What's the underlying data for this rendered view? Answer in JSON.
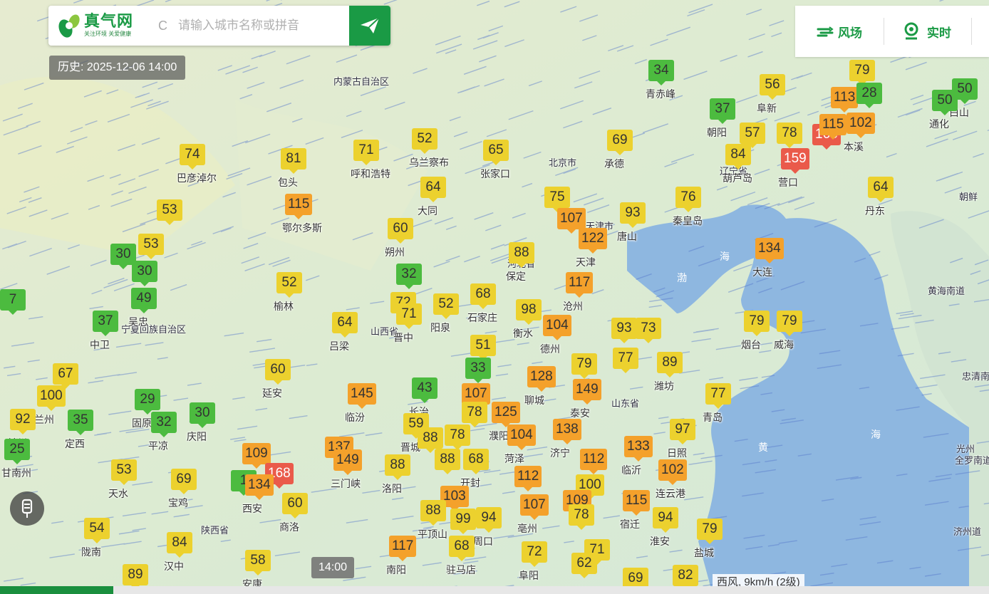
{
  "app": {
    "logo_name": "真气网",
    "logo_slogan": "关注环境 关爱健康",
    "search_placeholder": "请输入城市名称或拼音",
    "search_prefix": "C",
    "history_label": "历史: 2025-12-06 14:00",
    "modes": [
      {
        "label": "风场",
        "icon": "wind-icon"
      },
      {
        "label": "实时",
        "icon": "location-pin-icon"
      }
    ],
    "time_chip": "14:00",
    "wind_info": "西风, 9km/h (2级)",
    "timeline_progress": 0.34
  },
  "colors": {
    "brand": "#1a9a45",
    "good": "#4cbb3f",
    "moderate": "#ecd12e",
    "light": "#f4a12b",
    "medium": "#ea5a4a"
  },
  "map_labels": {
    "provinces": [
      "内蒙古自治区",
      "北京市",
      "天津市",
      "河北省",
      "山西省",
      "陕西省",
      "山东省",
      "宁夏回族自治区",
      "辽宁省"
    ],
    "seas": [
      "渤",
      "海",
      "黄",
      "海"
    ],
    "countries": [
      "朝鲜",
      "黄海南道",
      "忠清南道",
      "光州",
      "全罗南道",
      "济州道"
    ]
  },
  "markers": [
    {
      "v": "34",
      "c": "青赤峰"
    },
    {
      "v": "56",
      "c": "阜新"
    },
    {
      "v": "37",
      "c": "朝阳"
    },
    {
      "v": "57",
      "c": ""
    },
    {
      "v": "78",
      "c": ""
    },
    {
      "v": "166",
      "c": ""
    },
    {
      "v": "84",
      "c": "葫芦岛"
    },
    {
      "v": "159",
      "c": "营口"
    },
    {
      "v": "79",
      "c": ""
    },
    {
      "v": "113",
      "c": ""
    },
    {
      "v": "28",
      "c": ""
    },
    {
      "v": "115",
      "c": ""
    },
    {
      "v": "102",
      "c": "本溪"
    },
    {
      "v": "50",
      "c": "白山"
    },
    {
      "v": "50",
      "c": "通化"
    },
    {
      "v": "64",
      "c": "丹东"
    },
    {
      "v": "74",
      "c": "巴彦淖尔"
    },
    {
      "v": "81",
      "c": "包头"
    },
    {
      "v": "71",
      "c": "呼和浩特"
    },
    {
      "v": "52",
      "c": "乌兰察布"
    },
    {
      "v": "65",
      "c": "张家口"
    },
    {
      "v": "69",
      "c": "承德"
    },
    {
      "v": "115",
      "c": "鄂尔多斯"
    },
    {
      "v": "64",
      "c": "大同"
    },
    {
      "v": "75",
      "c": ""
    },
    {
      "v": "107",
      "c": ""
    },
    {
      "v": "93",
      "c": "唐山"
    },
    {
      "v": "76",
      "c": "秦皇岛"
    },
    {
      "v": "122",
      "c": "天津"
    },
    {
      "v": "53",
      "c": ""
    },
    {
      "v": "53",
      "c": ""
    },
    {
      "v": "30",
      "c": ""
    },
    {
      "v": "30",
      "c": ""
    },
    {
      "v": "49",
      "c": "吴忠"
    },
    {
      "v": "60",
      "c": "朔州"
    },
    {
      "v": "88",
      "c": "保定"
    },
    {
      "v": "134",
      "c": "大连"
    },
    {
      "v": "32",
      "c": ""
    },
    {
      "v": "52",
      "c": "榆林"
    },
    {
      "v": "117",
      "c": "沧州"
    },
    {
      "v": "37",
      "c": "中卫"
    },
    {
      "v": "64",
      "c": "吕梁"
    },
    {
      "v": "72",
      "c": ""
    },
    {
      "v": "71",
      "c": "晋中"
    },
    {
      "v": "52",
      "c": "阳泉"
    },
    {
      "v": "68",
      "c": "石家庄"
    },
    {
      "v": "98",
      "c": "衡水"
    },
    {
      "v": "104",
      "c": "德州"
    },
    {
      "v": "93",
      "c": ""
    },
    {
      "v": "73",
      "c": ""
    },
    {
      "v": "79",
      "c": "烟台"
    },
    {
      "v": "79",
      "c": "威海"
    },
    {
      "v": "51",
      "c": ""
    },
    {
      "v": "77",
      "c": ""
    },
    {
      "v": "89",
      "c": "潍坊"
    },
    {
      "v": "79",
      "c": ""
    },
    {
      "v": "67",
      "c": ""
    },
    {
      "v": "60",
      "c": "延安"
    },
    {
      "v": "33",
      "c": ""
    },
    {
      "v": "128",
      "c": "聊城"
    },
    {
      "v": "149",
      "c": "泰安"
    },
    {
      "v": "100",
      "c": "兰州"
    },
    {
      "v": "29",
      "c": "固原"
    },
    {
      "v": "145",
      "c": "临汾"
    },
    {
      "v": "43",
      "c": "长治"
    },
    {
      "v": "107",
      "c": ""
    },
    {
      "v": "77",
      "c": "青岛"
    },
    {
      "v": "92",
      "c": "兰州"
    },
    {
      "v": "35",
      "c": "定西"
    },
    {
      "v": "32",
      "c": "平凉"
    },
    {
      "v": "30",
      "c": "庆阳"
    },
    {
      "v": "78",
      "c": ""
    },
    {
      "v": "125",
      "c": "濮阳"
    },
    {
      "v": "59",
      "c": "晋城"
    },
    {
      "v": "88",
      "c": ""
    },
    {
      "v": "78",
      "c": ""
    },
    {
      "v": "104",
      "c": "菏泽"
    },
    {
      "v": "138",
      "c": "济宁"
    },
    {
      "v": "97",
      "c": "日照"
    },
    {
      "v": "25",
      "c": "甘南州"
    },
    {
      "v": "109",
      "c": ""
    },
    {
      "v": "137",
      "c": ""
    },
    {
      "v": "149",
      "c": "三门峡"
    },
    {
      "v": "88",
      "c": "洛阳"
    },
    {
      "v": "88",
      "c": ""
    },
    {
      "v": "68",
      "c": "开封"
    },
    {
      "v": "112",
      "c": ""
    },
    {
      "v": "133",
      "c": "临沂"
    },
    {
      "v": "102",
      "c": "连云港"
    },
    {
      "v": "168",
      "c": ""
    },
    {
      "v": "53",
      "c": "天水"
    },
    {
      "v": "69",
      "c": "宝鸡"
    },
    {
      "v": "1",
      "c": ""
    },
    {
      "v": "134",
      "c": "西安"
    },
    {
      "v": "112",
      "c": ""
    },
    {
      "v": "100",
      "c": ""
    },
    {
      "v": "103",
      "c": ""
    },
    {
      "v": "60",
      "c": "商洛"
    },
    {
      "v": "107",
      "c": "亳州"
    },
    {
      "v": "109",
      "c": ""
    },
    {
      "v": "115",
      "c": "宿迁"
    },
    {
      "v": "54",
      "c": "陇南"
    },
    {
      "v": "88",
      "c": "平顶山"
    },
    {
      "v": "99",
      "c": ""
    },
    {
      "v": "94",
      "c": "周口"
    },
    {
      "v": "78",
      "c": ""
    },
    {
      "v": "94",
      "c": "淮安"
    },
    {
      "v": "84",
      "c": "汉中"
    },
    {
      "v": "117",
      "c": "南阳"
    },
    {
      "v": "68",
      "c": "驻马店"
    },
    {
      "v": "72",
      "c": "阜阳"
    },
    {
      "v": "71",
      "c": ""
    },
    {
      "v": "79",
      "c": "盐城"
    },
    {
      "v": "58",
      "c": "安康"
    },
    {
      "v": "62",
      "c": ""
    },
    {
      "v": "89",
      "c": ""
    },
    {
      "v": "69",
      "c": ""
    },
    {
      "v": "82",
      "c": ""
    },
    {
      "v": "7",
      "c": ""
    }
  ]
}
